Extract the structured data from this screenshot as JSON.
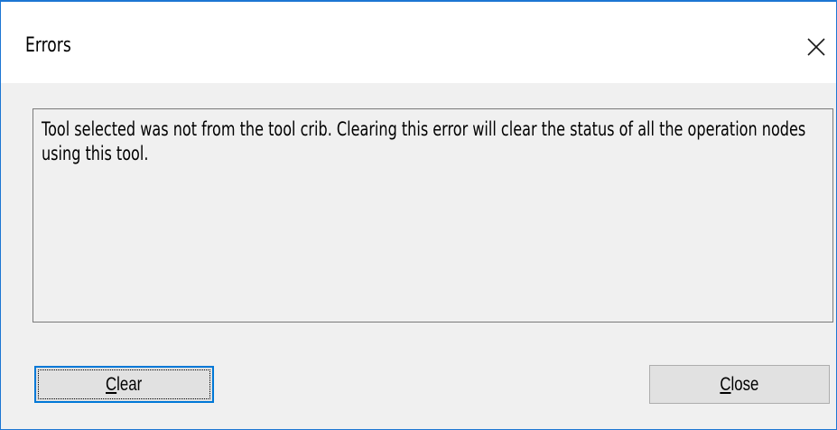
{
  "dialog": {
    "title": "Errors",
    "close_icon": "close-icon"
  },
  "message": {
    "text": "Tool selected was not from the tool crib. Clearing this error will clear the status of all the operation nodes using this tool."
  },
  "buttons": {
    "clear": {
      "mnemonic": "C",
      "rest": "lear"
    },
    "close": {
      "mnemonic": "C",
      "rest": "lose"
    }
  },
  "colors": {
    "window_border": "#1c76d3",
    "dialog_background": "#f0f0f0",
    "focus_border": "#0078d7"
  }
}
